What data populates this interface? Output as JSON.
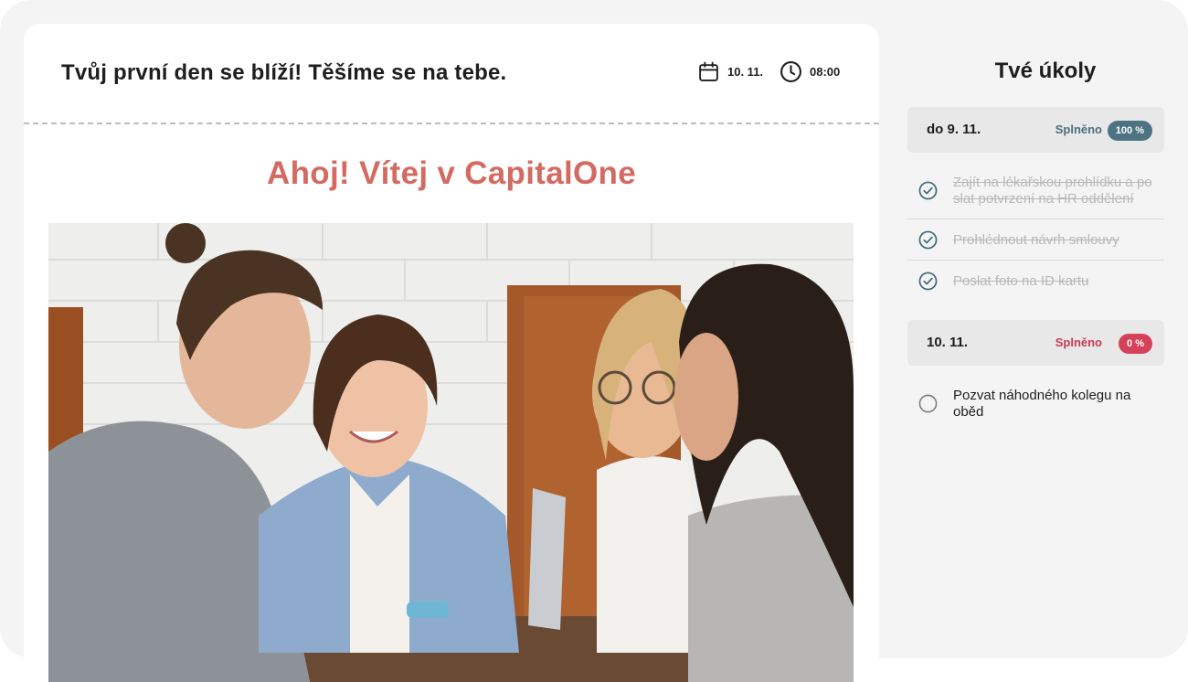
{
  "card": {
    "headline": "Tvůj první den se blíží! Těšíme se na tebe.",
    "date": "10. 11.",
    "time": "08:00",
    "welcome": "Ahoj! Vítej v CapitalOne"
  },
  "sidebar": {
    "title": "Tvé úkoly",
    "groups": [
      {
        "label": "do 9. 11.",
        "status": "Splněno",
        "percent": "100 %",
        "tasks": [
          {
            "text": "Zajít na lékařskou prohlídku a po slat potvrzení na HR oddělení",
            "done": true
          },
          {
            "text": "Prohlédnout návrh smlouvy",
            "done": true
          },
          {
            "text": "Poslat foto na ID kartu",
            "done": true
          }
        ]
      },
      {
        "label": "10. 11.",
        "status": "Splněno",
        "percent": "0 %",
        "tasks": [
          {
            "text": "Pozvat náhodného kolegu na oběd",
            "done": false
          }
        ]
      }
    ]
  },
  "colors": {
    "accent": "#d36b62",
    "done_badge": "#4d7383",
    "todo_badge": "#d64159"
  }
}
